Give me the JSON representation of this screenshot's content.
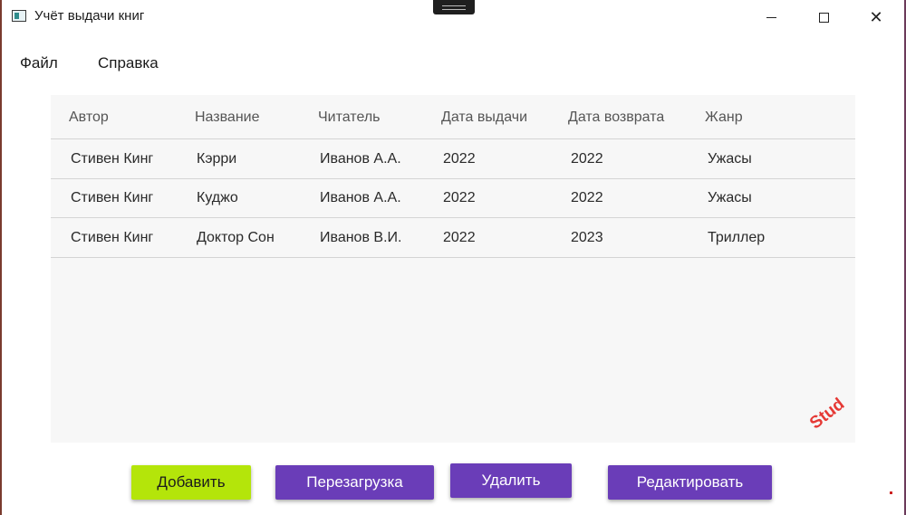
{
  "window": {
    "title": "Учёт выдачи книг"
  },
  "menu": {
    "file": "Файл",
    "help": "Справка"
  },
  "table": {
    "columns": [
      "Автор",
      "Название",
      "Читатель",
      "Дата выдачи",
      "Дата возврата",
      "Жанр"
    ],
    "rows": [
      [
        "Стивен Кинг",
        "Кэрри",
        "Иванов А.А.",
        "2022",
        "2022",
        "Ужасы"
      ],
      [
        "Стивен Кинг",
        "Куджо",
        "Иванов А.А.",
        "2022",
        "2022",
        "Ужасы"
      ],
      [
        "Стивен Кинг",
        "Доктор Сон",
        "Иванов В.И.",
        "2022",
        "2023",
        "Триллер"
      ]
    ]
  },
  "buttons": {
    "add": "Добавить",
    "reload": "Перезагрузка",
    "delete": "Удалить",
    "edit": "Редактировать"
  },
  "watermark": {
    "text": "Stud"
  },
  "colors": {
    "add_button": "#b4e50a",
    "action_button": "#6a3db8",
    "grid_background": "#f7f7f7"
  }
}
